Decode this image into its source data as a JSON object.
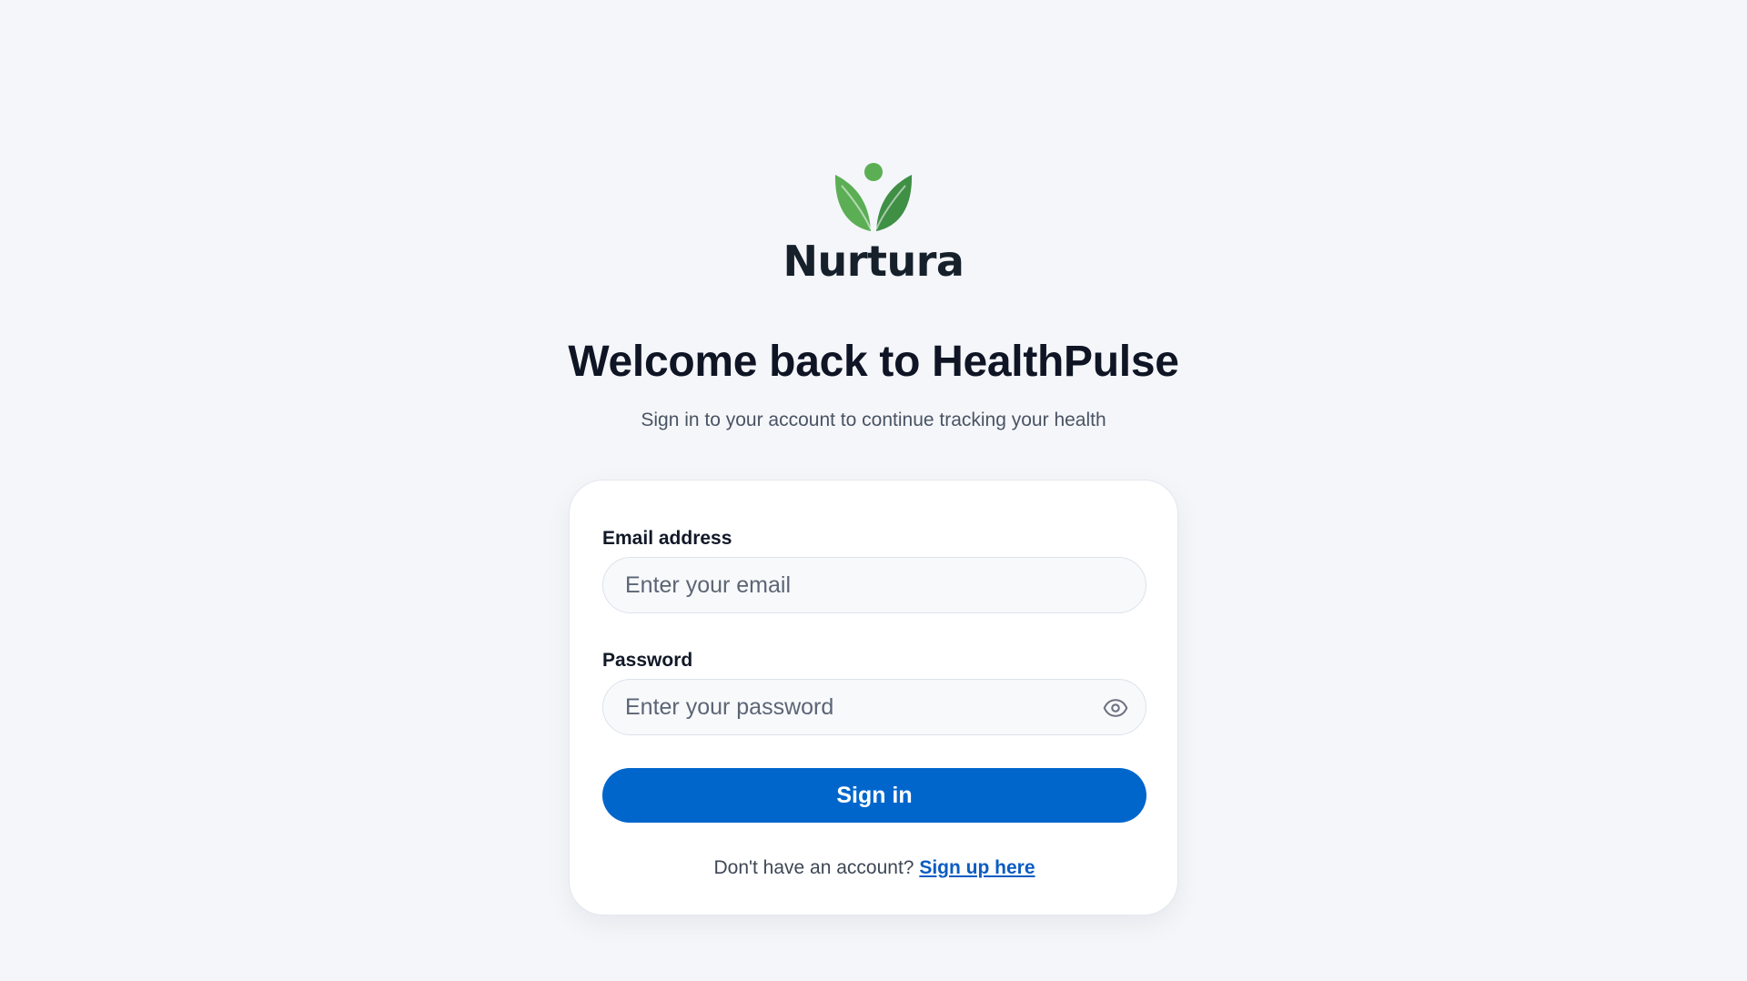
{
  "brand": {
    "name": "Nurtura"
  },
  "header": {
    "title": "Welcome back to HealthPulse",
    "subtitle": "Sign in to your account to continue tracking your health"
  },
  "form": {
    "email_label": "Email address",
    "email_placeholder": "Enter your email",
    "email_value": "",
    "password_label": "Password",
    "password_placeholder": "Enter your password",
    "password_value": "",
    "password_toggle_icon": "eye-icon",
    "submit_label": "Sign in"
  },
  "footer": {
    "prompt": "Don't have an account? ",
    "link_label": "Sign up here"
  },
  "colors": {
    "background": "#f4f6fa",
    "primary": "#0066cc",
    "link": "#0b5cc2",
    "leaf_light": "#5cae55",
    "leaf_dark": "#3f8f45"
  }
}
